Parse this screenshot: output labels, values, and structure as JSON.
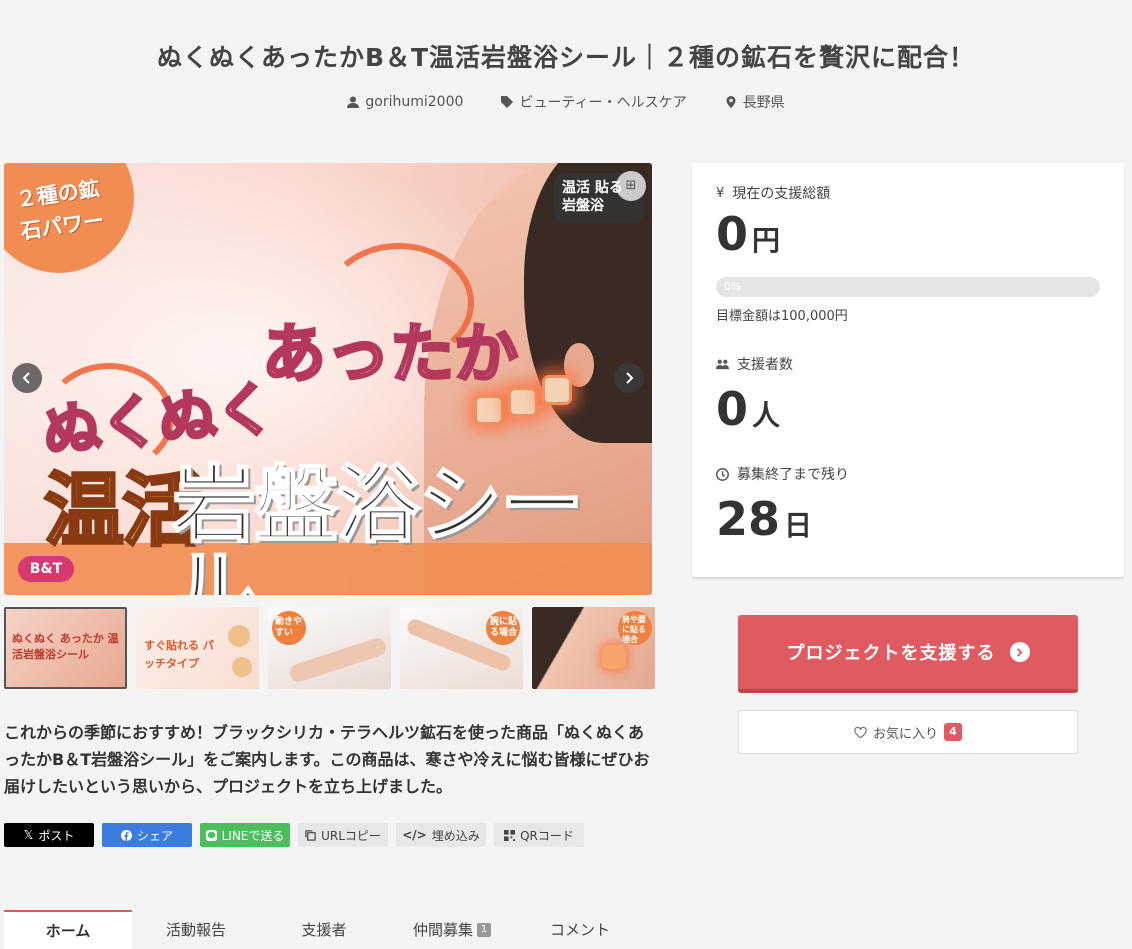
{
  "project": {
    "title": "ぬくぬくあったかB＆T温活岩盤浴シール｜２種の鉱石を贅沢に配合！",
    "author": "gorihumi2000",
    "category": "ビューティー・ヘルスケア",
    "location": "長野県"
  },
  "hero": {
    "badge": "２種の鉱石パワー",
    "corner_tag": "温活 貼る岩盤浴",
    "headline_small_1": "ぬくぬく",
    "headline_small_2": "あったか",
    "headline_big_1": "温活",
    "headline_big_2": "岩盤浴シール",
    "brand": "B&T"
  },
  "thumbnails": [
    {
      "label": "ぬくぬく あったか 温活岩盤浴シール"
    },
    {
      "label": "すぐ貼れる パッチタイプ"
    },
    {
      "label": "動きやすい"
    },
    {
      "label": "腕に貼る場合"
    },
    {
      "label": "肩や腰に貼る場合"
    }
  ],
  "description": "これからの季節におすすめ！ブラックシリカ・テラヘルツ鉱石を使った商品「ぬくぬくあったかB＆T岩盤浴シール」をご案内します。この商品は、寒さや冷えに悩む皆様にぜひお届けしたいという思いから、プロジェクトを立ち上げました。",
  "share": {
    "x": "ポスト",
    "facebook": "シェア",
    "line": "LINEで送る",
    "url": "URLコピー",
    "embed": "埋め込み",
    "qr": "QRコード"
  },
  "tabs": [
    {
      "label": "ホーム",
      "active": true
    },
    {
      "label": "活動報告"
    },
    {
      "label": "支援者"
    },
    {
      "label": "仲間募集",
      "count": "1"
    },
    {
      "label": "コメント"
    }
  ],
  "stats": {
    "total_label": "現在の支援総額",
    "total_value": "0",
    "total_unit": "円",
    "progress_percent": 0,
    "progress_text": "0%",
    "goal_text": "目標金額は100,000円",
    "backers_label": "支援者数",
    "backers_value": "0",
    "backers_unit": "人",
    "remaining_label": "募集終了まで残り",
    "remaining_value": "28",
    "remaining_unit": "日"
  },
  "actions": {
    "support_label": "プロジェクトを支援する",
    "favorite_label": "お気に入り",
    "favorite_count": "4"
  },
  "colors": {
    "accent": "#e05a61",
    "facebook": "#3b7ce0",
    "line": "#4bbf5d"
  }
}
